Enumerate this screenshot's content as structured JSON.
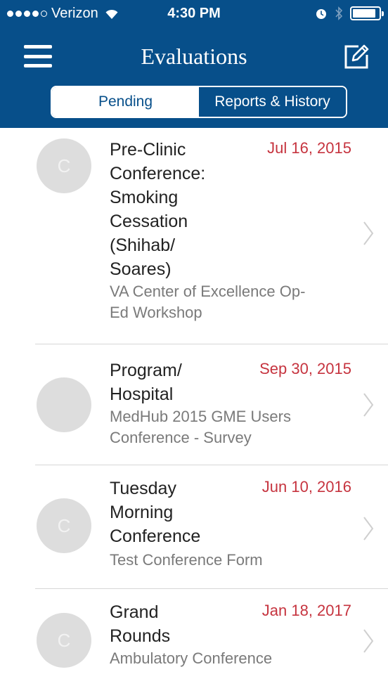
{
  "status_bar": {
    "carrier": "Verizon",
    "time": "4:30 PM",
    "battery_level": 0.9,
    "icons": [
      "signal-dots-icon",
      "wifi-icon",
      "alarm-icon",
      "bluetooth-icon",
      "battery-icon"
    ]
  },
  "nav": {
    "title": "Evaluations",
    "left_icon": "hamburger-menu-icon",
    "right_icon": "compose-icon"
  },
  "tabs": [
    {
      "label": "Pending",
      "selected": true
    },
    {
      "label": "Reports & History",
      "selected": false
    }
  ],
  "colors": {
    "header": "#074f8a",
    "date": "#c6343f",
    "avatar": "#dddddd"
  },
  "evaluations": [
    {
      "avatar": "C",
      "title_lines": [
        "Pre-Clinic",
        "Conference:",
        "Smoking",
        "Cessation",
        "(Shihab/",
        "Soares)"
      ],
      "subtitle_lines": [
        "VA Center of Excellence Op-",
        "Ed Workshop"
      ],
      "date": "Jul 16, 2015"
    },
    {
      "avatar": "",
      "title_lines": [
        "Program/",
        "Hospital"
      ],
      "subtitle_lines": [
        "MedHub 2015 GME Users",
        "Conference - Survey"
      ],
      "date": "Sep 30, 2015"
    },
    {
      "avatar": "C",
      "title_lines": [
        "Tuesday",
        "Morning",
        "Conference"
      ],
      "subtitle_lines": [
        "Test Conference Form"
      ],
      "date": "Jun 10, 2016"
    },
    {
      "avatar": "C",
      "title_lines": [
        "Grand",
        "Rounds"
      ],
      "subtitle_lines": [
        "Ambulatory Conference"
      ],
      "date": "Jan 18, 2017"
    }
  ]
}
